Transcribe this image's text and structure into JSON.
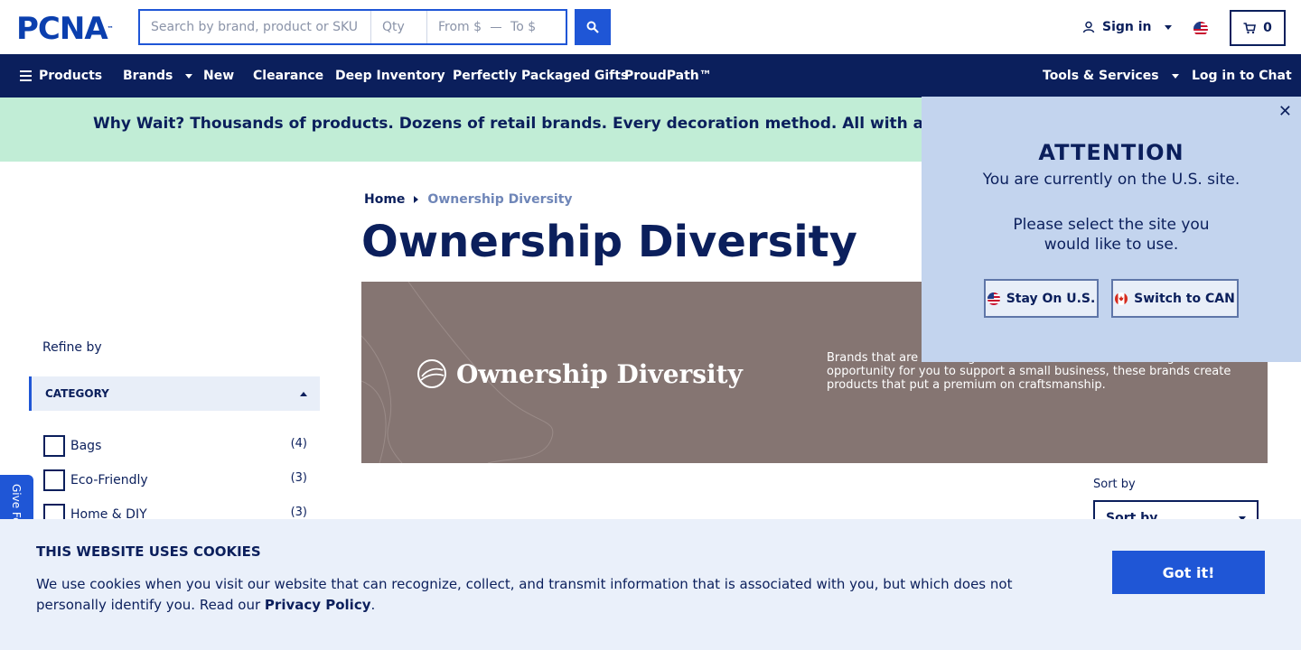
{
  "header": {
    "logo": "PCNA",
    "logo_tm": "™",
    "search_placeholder": "Search by brand, product or SKU",
    "qty_placeholder": "Qty",
    "from_placeholder": "From $",
    "to_placeholder": "To $",
    "signin_label": "Sign in",
    "cart_count": "0"
  },
  "nav": {
    "products": "Products",
    "brands": "Brands",
    "new": "New",
    "clearance": "Clearance",
    "deep_inventory": "Deep Inventory",
    "gifts": "Perfectly Packaged Gifts",
    "proudpath": "ProudPath™",
    "tools": "Tools & Services",
    "chat": "Log in to Chat"
  },
  "promo": {
    "text": "Why Wait? Thousands of products. Dozens of retail brands. Every decoration method. All with a standard"
  },
  "breadcrumb": {
    "home": "Home",
    "current": "Ownership Diversity"
  },
  "page_title": "Ownership Diversity",
  "hero": {
    "brand_name": "Ownership Diversity",
    "description": "Brands that are including women-owned businesses. Along with the opportunity for you to support a small business, these brands create products that put a premium on craftsmanship."
  },
  "sidebar": {
    "refine_label": "Refine by",
    "category_label": "CATEGORY",
    "categories": [
      {
        "label": "Bags",
        "count": "(4)"
      },
      {
        "label": "Eco-Friendly",
        "count": "(3)"
      },
      {
        "label": "Home & DIY",
        "count": "(3)"
      }
    ]
  },
  "feedback_label": "Give Feedback",
  "sort": {
    "label": "Sort by",
    "selected": "Sort by"
  },
  "attention": {
    "title": "ATTENTION",
    "line1": "You are currently on the U.S. site.",
    "line2": "Please select the site you",
    "line3": "would like to use.",
    "stay_label": "Stay On U.S.",
    "switch_label": "Switch to CAN",
    "close_glyph": "✕"
  },
  "cookie": {
    "title": "THIS WEBSITE USES COOKIES",
    "text": "We use cookies when you visit our website that can recognize, collect, and transmit information that is associated with you, but which does not personally identify you. Read our",
    "link": "Privacy Policy",
    "period": ".",
    "button": "Got it!"
  },
  "colors": {
    "navy": "#0b1f5c",
    "blue": "#1f56d6",
    "promo_bg": "#c1edd6",
    "modal_bg": "#c3d4ee",
    "hero_bg": "#857572"
  }
}
